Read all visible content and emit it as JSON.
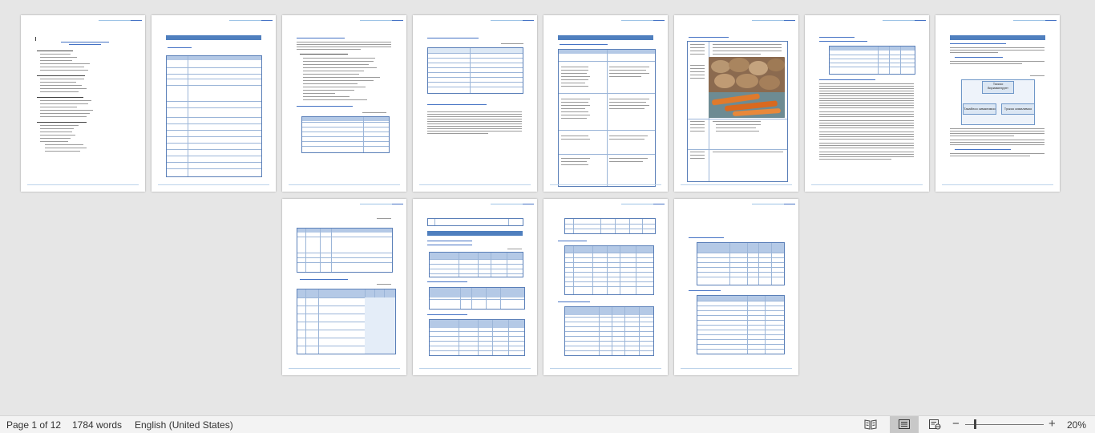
{
  "status_bar": {
    "page_info": "Page 1 of 12",
    "word_count": "1784 words",
    "language": "English (United States)",
    "zoom_level": "20%",
    "zoom_out": "−",
    "zoom_in": "+"
  },
  "view_modes": [
    {
      "icon": "read-mode-icon",
      "active": false
    },
    {
      "icon": "print-layout-icon",
      "active": true
    },
    {
      "icon": "web-layout-icon",
      "active": false
    }
  ],
  "document": {
    "total_pages": 12,
    "pages_per_row": 8,
    "diagram": {
      "top_box": "Тоскоо\nбирикмелуунт",
      "left_box": "Тазаблоо сималимоо",
      "right_box": "Тускоо сималимоо"
    }
  },
  "colors": {
    "accent_blue": "#4f7fbe",
    "table_header": "#b4c9e6",
    "background": "#e6e6e6",
    "status_bar": "#f3f3f3"
  }
}
